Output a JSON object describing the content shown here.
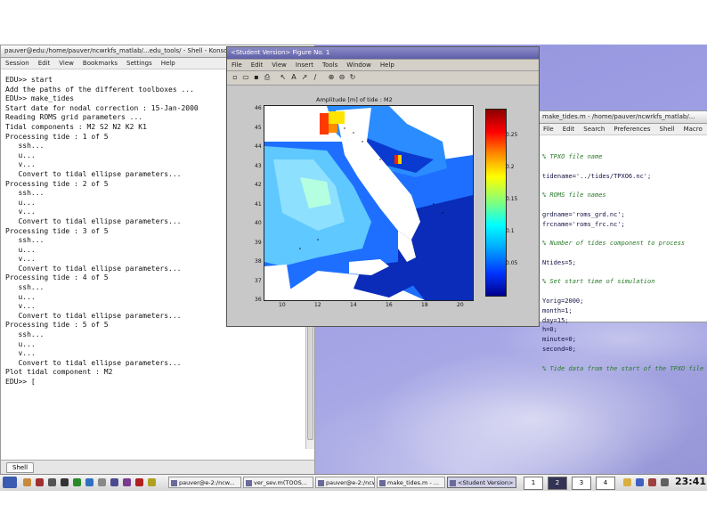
{
  "terminal": {
    "title": "pauver@edu:/home/pauver/ncwrkfs_matlab/...edu_tools/ - Shell - Konsole",
    "menu": [
      "Session",
      "Edit",
      "View",
      "Bookmarks",
      "Settings",
      "Help"
    ],
    "lines": [
      "EDU>> start",
      "Add the paths of the different toolboxes ...",
      "EDU>> make_tides",
      "Start date for nodal correction : 15-Jan-2000",
      "Reading ROMS grid parameters ...",
      "Tidal components : M2 S2 N2 K2 K1",
      "Processing tide : 1 of 5",
      "   ssh...",
      "   u...",
      "   v...",
      "   Convert to tidal ellipse parameters...",
      "Processing tide : 2 of 5",
      "   ssh...",
      "   u...",
      "   v...",
      "   Convert to tidal ellipse parameters...",
      "Processing tide : 3 of 5",
      "   ssh...",
      "   u...",
      "   v...",
      "   Convert to tidal ellipse parameters...",
      "Processing tide : 4 of 5",
      "   ssh...",
      "   u...",
      "   v...",
      "   Convert to tidal ellipse parameters...",
      "Processing tide : 5 of 5",
      "   ssh...",
      "   u...",
      "   v...",
      "   Convert to tidal ellipse parameters...",
      "Plot tidal component : M2",
      "EDU>> [ "
    ],
    "tab_label": "Shell"
  },
  "figure": {
    "title": "<Student Version> Figure No. 1",
    "menu": [
      "File",
      "Edit",
      "View",
      "Insert",
      "Tools",
      "Window",
      "Help"
    ],
    "plot_title": "Amplitude [m] of tide : M2",
    "x_ticks": [
      "10",
      "12",
      "14",
      "16",
      "18",
      "20"
    ],
    "y_ticks": [
      "46",
      "45",
      "44",
      "43",
      "42",
      "41",
      "40",
      "39",
      "38",
      "37",
      "36"
    ],
    "cbar_ticks": [
      "0.25",
      "0.2",
      "0.15",
      "0.1",
      "0.05"
    ]
  },
  "editor": {
    "title": "make_tides.m - /home/pauver/ncwrkfs_matlab/...",
    "menu": [
      "File",
      "Edit",
      "Search",
      "Preferences",
      "Shell",
      "Macro"
    ],
    "lines": [
      {
        "t": "% TPXO file name",
        "c": true
      },
      {
        "t": "",
        "c": false
      },
      {
        "t": "tidename='../tides/TPXO6.nc';",
        "c": false
      },
      {
        "t": "",
        "c": false
      },
      {
        "t": "% ROMS file names",
        "c": true
      },
      {
        "t": "",
        "c": false
      },
      {
        "t": "grdname='roms_grd.nc';",
        "c": false
      },
      {
        "t": "frcname='roms_frc.nc';",
        "c": false
      },
      {
        "t": "",
        "c": false
      },
      {
        "t": "% Number of tides component to process",
        "c": true
      },
      {
        "t": "",
        "c": false
      },
      {
        "t": "Ntides=5;",
        "c": false
      },
      {
        "t": "",
        "c": false
      },
      {
        "t": "% Set start time of simulation",
        "c": true
      },
      {
        "t": "",
        "c": false
      },
      {
        "t": "Yorig=2000;",
        "c": false
      },
      {
        "t": "month=1;",
        "c": false
      },
      {
        "t": "day=15;",
        "c": false
      },
      {
        "t": "h=0;",
        "c": false
      },
      {
        "t": "minute=0;",
        "c": false
      },
      {
        "t": "second=0;",
        "c": false
      },
      {
        "t": "",
        "c": false
      },
      {
        "t": "% Tide data from the start of the TPXO file",
        "c": true
      }
    ]
  },
  "taskbar": {
    "buttons": [
      {
        "label": "pauver@e-2:/ncw...",
        "active": false
      },
      {
        "label": "ver_sev.m(TOOS...",
        "active": false
      },
      {
        "label": "pauver@e-2:/ncw...",
        "active": false
      },
      {
        "label": "make_tides.m - ...",
        "active": false
      },
      {
        "label": "<Student Version>",
        "active": true
      }
    ],
    "pager": [
      "1",
      "2",
      "3",
      "4"
    ],
    "clock": "23:41"
  },
  "colors": {
    "figure_title": "#5e5ea8",
    "desktop": "#9c9ce3",
    "comment": "#2a7a2a"
  }
}
